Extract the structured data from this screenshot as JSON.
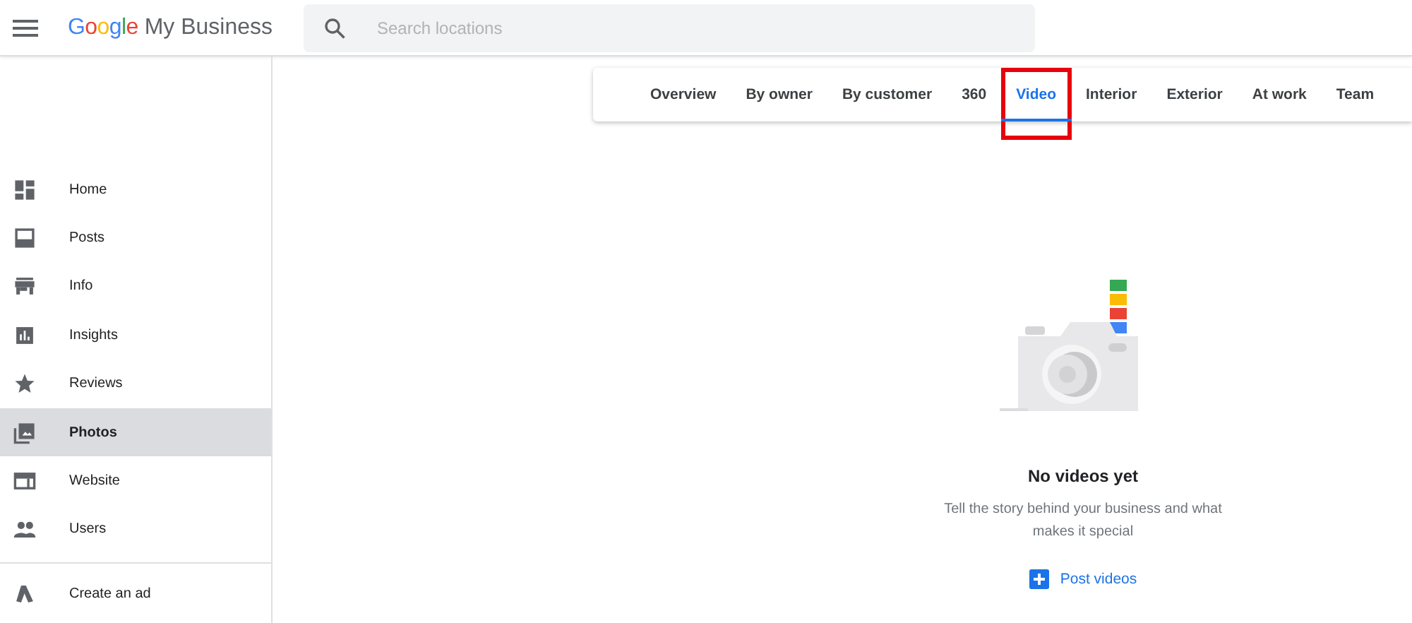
{
  "header": {
    "logo_brand": "Google",
    "logo_product": "My Business",
    "search": {
      "placeholder": "Search locations"
    }
  },
  "sidebar": {
    "items": [
      {
        "label": "Home",
        "selected": false
      },
      {
        "label": "Posts",
        "selected": false
      },
      {
        "label": "Info",
        "selected": false
      },
      {
        "label": "Insights",
        "selected": false
      },
      {
        "label": "Reviews",
        "selected": false
      },
      {
        "label": "Photos",
        "selected": true
      },
      {
        "label": "Website",
        "selected": false
      },
      {
        "label": "Users",
        "selected": false
      }
    ],
    "footer_item": {
      "label": "Create an ad"
    }
  },
  "tabs": [
    {
      "label": "Overview",
      "selected": false,
      "highlighted": false
    },
    {
      "label": "By owner",
      "selected": false,
      "highlighted": false
    },
    {
      "label": "By customer",
      "selected": false,
      "highlighted": false
    },
    {
      "label": "360",
      "selected": false,
      "highlighted": false
    },
    {
      "label": "Video",
      "selected": true,
      "highlighted": true
    },
    {
      "label": "Interior",
      "selected": false,
      "highlighted": false
    },
    {
      "label": "Exterior",
      "selected": false,
      "highlighted": false
    },
    {
      "label": "At work",
      "selected": false,
      "highlighted": false
    },
    {
      "label": "Team",
      "selected": false,
      "highlighted": false
    }
  ],
  "empty_state": {
    "title": "No videos yet",
    "description": "Tell the story behind your business and what makes it special",
    "action": "Post videos"
  }
}
